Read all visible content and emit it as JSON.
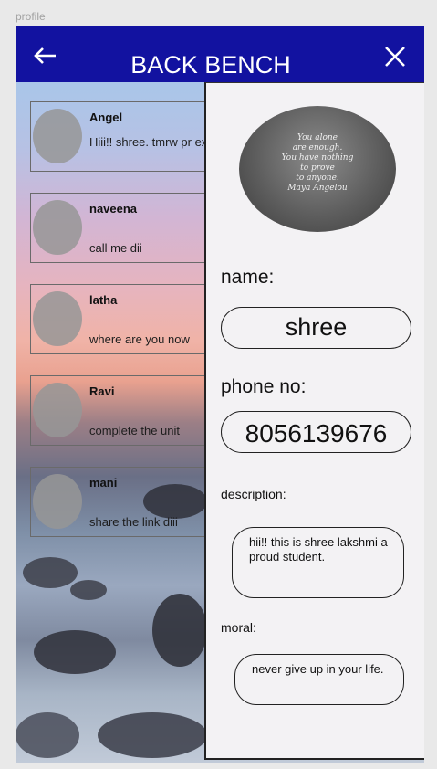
{
  "frame": {
    "label": "profile"
  },
  "header": {
    "title": "BACK BENCH",
    "back_icon": "arrow-left-icon",
    "close_icon": "close-icon",
    "bg_color": "#1212a0"
  },
  "chats": [
    {
      "name": "Angel",
      "message": "Hiii!! shree. tmrw pr exam"
    },
    {
      "name": "naveena",
      "message": "call me dii"
    },
    {
      "name": "latha",
      "message": "where are you now"
    },
    {
      "name": "Ravi",
      "message": "complete the unit"
    },
    {
      "name": "mani",
      "message": "share the link diii"
    }
  ],
  "profile": {
    "picture_quote": [
      "You alone",
      "are enough.",
      "You have nothing",
      "to prove",
      "to anyone.",
      "Maya Angelou"
    ],
    "name_label": "name:",
    "name_value": "shree",
    "phone_label": "phone no:",
    "phone_value": "8056139676",
    "description_label": "description:",
    "description_value": "hii!! this is shree lakshmi a proud student.",
    "moral_label": "moral:",
    "moral_value": "never give up in your life."
  }
}
